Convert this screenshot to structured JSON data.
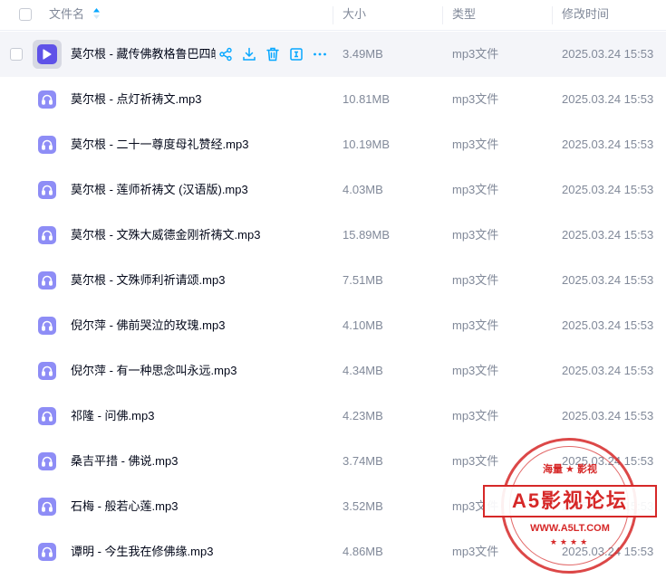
{
  "header": {
    "name_label": "文件名",
    "size_label": "大小",
    "type_label": "类型",
    "time_label": "修改时间"
  },
  "files": [
    {
      "name": "莫尔根 - 藏传佛教格鲁巴四皈依",
      "size": "3.49MB",
      "type": "mp3文件",
      "time": "2025.03.24 15:53",
      "icon": "video-play-icon"
    },
    {
      "name": "莫尔根 - 点灯祈祷文.mp3",
      "size": "10.81MB",
      "type": "mp3文件",
      "time": "2025.03.24 15:53",
      "icon": "audio-file-icon"
    },
    {
      "name": "莫尔根 - 二十一尊度母礼赞经.mp3",
      "size": "10.19MB",
      "type": "mp3文件",
      "time": "2025.03.24 15:53",
      "icon": "audio-file-icon"
    },
    {
      "name": "莫尔根 - 莲师祈祷文 (汉语版).mp3",
      "size": "4.03MB",
      "type": "mp3文件",
      "time": "2025.03.24 15:53",
      "icon": "audio-file-icon"
    },
    {
      "name": "莫尔根 - 文殊大威德金刚祈祷文.mp3",
      "size": "15.89MB",
      "type": "mp3文件",
      "time": "2025.03.24 15:53",
      "icon": "audio-file-icon"
    },
    {
      "name": "莫尔根 - 文殊师利祈请颂.mp3",
      "size": "7.51MB",
      "type": "mp3文件",
      "time": "2025.03.24 15:53",
      "icon": "audio-file-icon"
    },
    {
      "name": "倪尔萍 - 佛前哭泣的玫瑰.mp3",
      "size": "4.10MB",
      "type": "mp3文件",
      "time": "2025.03.24 15:53",
      "icon": "audio-file-icon"
    },
    {
      "name": "倪尔萍 - 有一种思念叫永远.mp3",
      "size": "4.34MB",
      "type": "mp3文件",
      "time": "2025.03.24 15:53",
      "icon": "audio-file-icon"
    },
    {
      "name": "祁隆 - 问佛.mp3",
      "size": "4.23MB",
      "type": "mp3文件",
      "time": "2025.03.24 15:53",
      "icon": "audio-file-icon"
    },
    {
      "name": "桑吉平措 - 佛说.mp3",
      "size": "3.74MB",
      "type": "mp3文件",
      "time": "2025.03.24 15:53",
      "icon": "audio-file-icon"
    },
    {
      "name": "石梅 - 般若心莲.mp3",
      "size": "3.52MB",
      "type": "mp3文件",
      "time": "2025.03.24 15:53",
      "icon": "audio-file-icon"
    },
    {
      "name": "谭明 - 今生我在修佛缘.mp3",
      "size": "4.86MB",
      "type": "mp3文件",
      "time": "2025.03.24 15:53",
      "icon": "audio-file-icon"
    }
  ],
  "row_actions": [
    "share-icon",
    "download-icon",
    "delete-icon",
    "details-icon",
    "more-icon"
  ],
  "watermark": {
    "top_text": "海量 ★ 影视",
    "main_text": "A5影视论坛",
    "url_text": "WWW.A5LT.COM",
    "stars": "★★★★"
  },
  "colors": {
    "accent": "#06a7ff",
    "audio_icon": "#8e8df6",
    "video_icon": "#5f52e8",
    "text_primary": "#03081a",
    "text_secondary": "#818999",
    "row_active_bg": "#f4f5f9",
    "stamp_red": "#d62828"
  }
}
